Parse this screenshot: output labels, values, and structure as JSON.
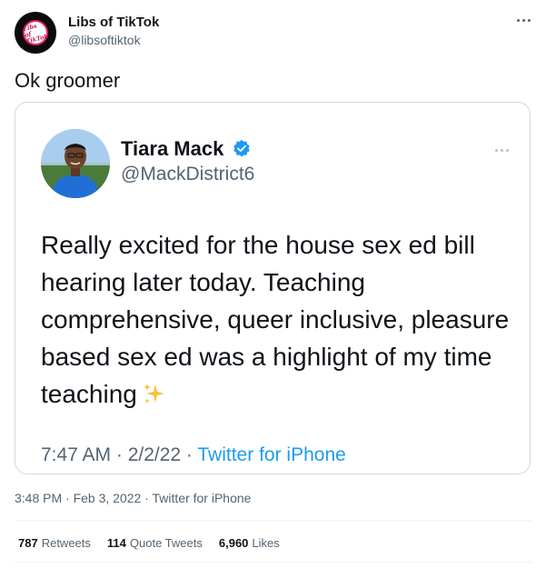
{
  "tweet": {
    "author": {
      "display_name": "Libs of TikTok",
      "handle": "@libsoftiktok",
      "avatar_text": [
        "Libs of",
        "TikTok"
      ]
    },
    "text": "Ok groomer",
    "timestamp": "3:48 PM · Feb 3, 2022 · ",
    "source": "Twitter for iPhone",
    "stats": {
      "retweets_count": "787",
      "retweets_label": "Retweets",
      "quotes_count": "114",
      "quotes_label": "Quote Tweets",
      "likes_count": "6,960",
      "likes_label": "Likes"
    }
  },
  "quoted_screenshot": {
    "author": {
      "display_name": "Tiara Mack",
      "handle": "@MackDistrict6",
      "verified": true
    },
    "text": "Really excited for the house sex ed bill hearing later today. Teaching comprehensive, queer inclusive, pleasure based sex ed was a highlight of my time teaching",
    "emoji": "sparkles-icon",
    "timestamp": "7:47 AM · 2/2/22 · ",
    "source": "Twitter for iPhone"
  },
  "colors": {
    "accent": "#1d9bf0",
    "muted": "#536471",
    "border": "#cfd9de",
    "avatar_ring": "#e0245e"
  }
}
